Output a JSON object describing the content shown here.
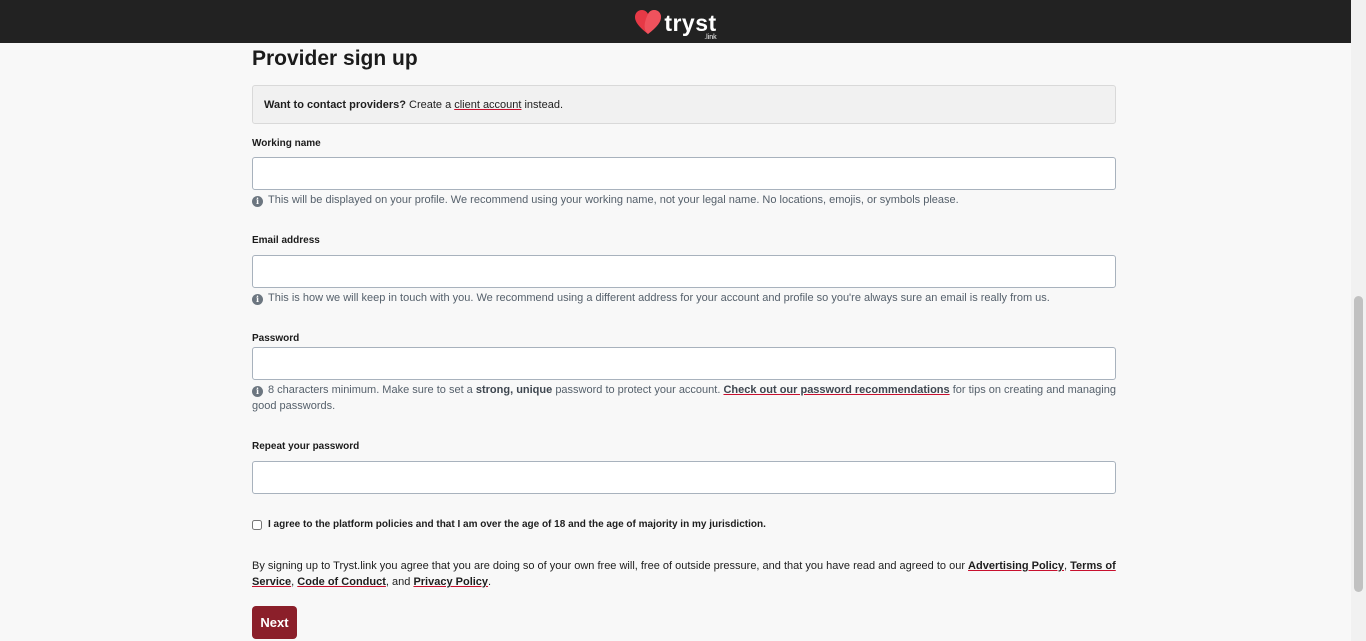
{
  "header": {
    "logo_text": "tryst",
    "logo_sub": ".link",
    "brand_color": "#e63946"
  },
  "page": {
    "title": "Provider sign up"
  },
  "notice": {
    "bold": "Want to contact providers?",
    "pre": "Create a",
    "link": "client account",
    "post": "instead."
  },
  "fields": {
    "working_name": {
      "label": "Working name",
      "value": "",
      "hint": "This will be displayed on your profile. We recommend using your working name, not your legal name. No locations, emojis, or symbols please."
    },
    "email": {
      "label": "Email address",
      "value": "",
      "hint": "This is how we will keep in touch with you. We recommend using a different address for your account and profile so you're always sure an email is really from us."
    },
    "password": {
      "label": "Password",
      "value": "",
      "hint_pre": "8 characters minimum. Make sure to set a",
      "hint_bold": "strong, unique",
      "hint_mid": "password to protect your account.",
      "hint_link": "Check out our password recommendations",
      "hint_post": "for tips on creating and managing good passwords."
    },
    "repeat_password": {
      "label": "Repeat your password",
      "value": ""
    }
  },
  "agree": {
    "label": "I agree to the platform policies and that I am over the age of 18 and the age of majority in my jurisdiction.",
    "checked": false
  },
  "legal": {
    "pre": "By signing up to Tryst.link you agree that you are doing so of your own free will, free of outside pressure, and that you have read and agreed to our",
    "advertising": "Advertising Policy",
    "terms": "Terms of Service",
    "conduct": "Code of Conduct",
    "and": "and",
    "privacy": "Privacy Policy"
  },
  "actions": {
    "next_label": "Next",
    "button_color": "#8b1f2a"
  }
}
